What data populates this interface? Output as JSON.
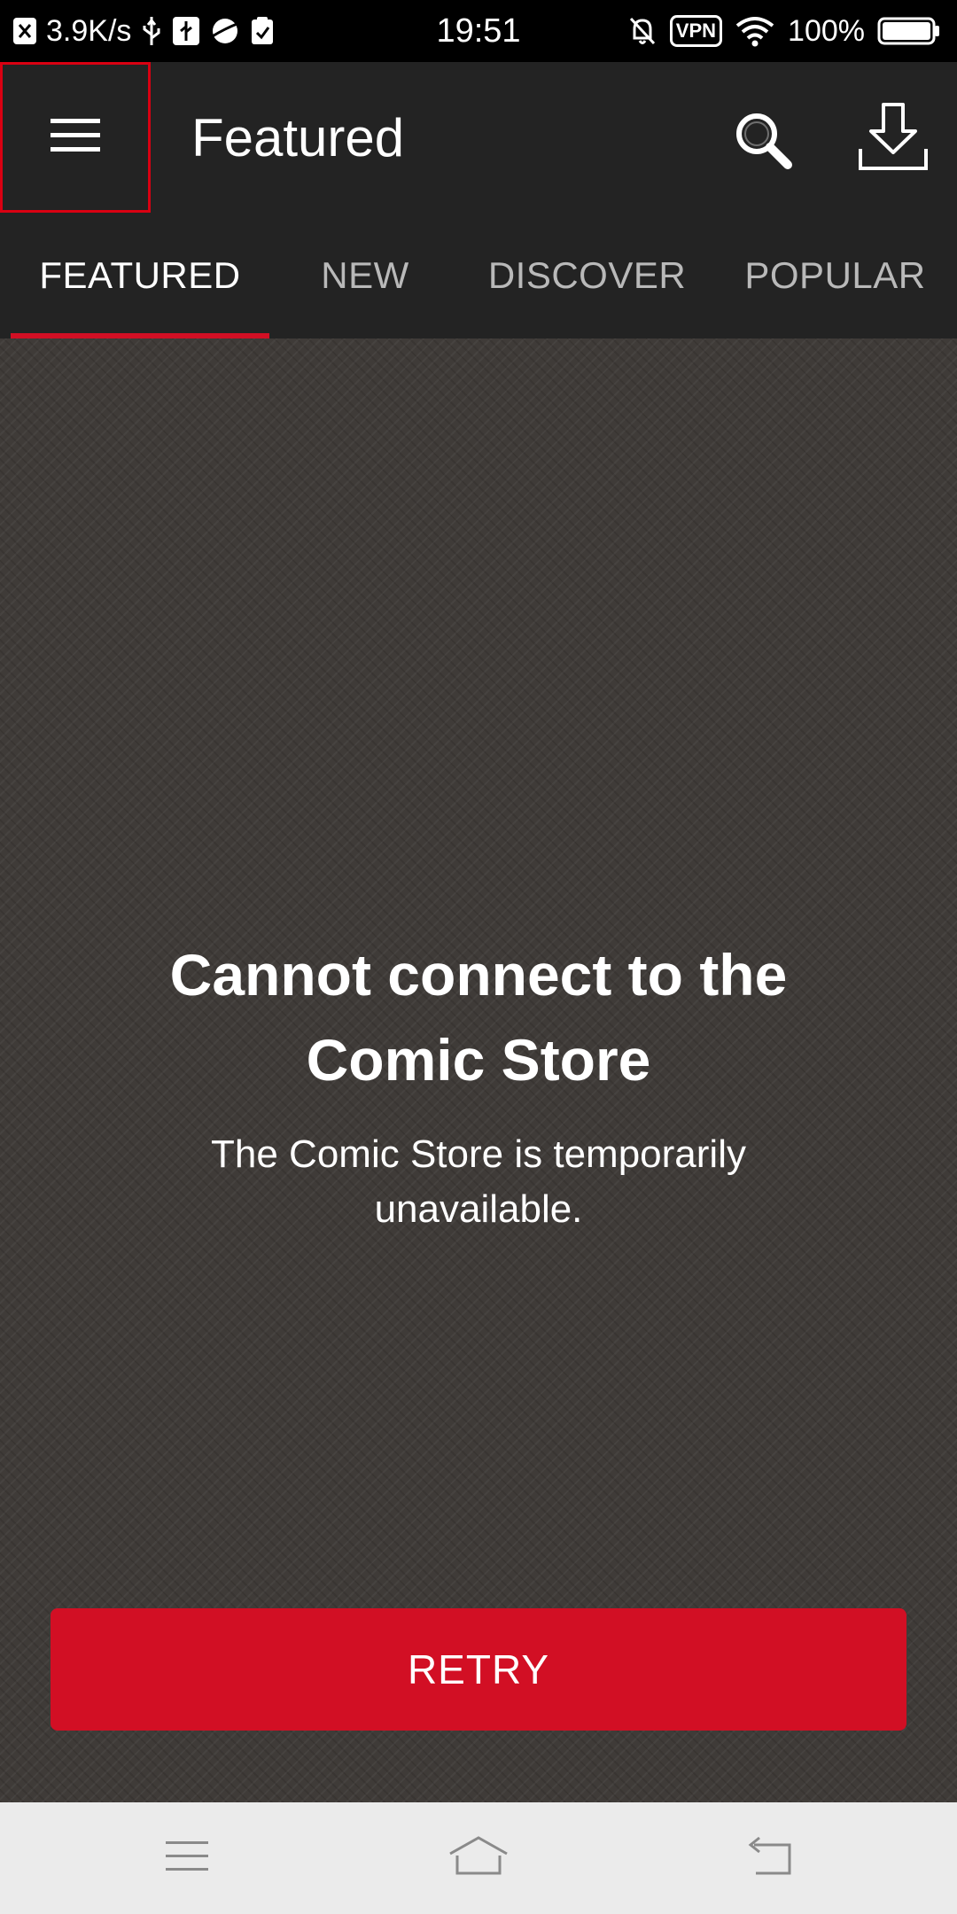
{
  "status_bar": {
    "network_speed": "3.9K/s",
    "time": "19:51",
    "vpn_label": "VPN",
    "battery_percent": "100%",
    "battery_level": 1.0
  },
  "app_bar": {
    "title": "Featured"
  },
  "tabs": [
    {
      "label": "FEATURED",
      "active": true
    },
    {
      "label": "NEW",
      "active": false
    },
    {
      "label": "DISCOVER",
      "active": false
    },
    {
      "label": "POPULAR",
      "active": false
    }
  ],
  "error": {
    "heading_line1": "Cannot connect to the",
    "heading_line2": "Comic Store",
    "message_line1": "The Comic Store is temporarily",
    "message_line2": "unavailable."
  },
  "retry_label": "RETRY",
  "colors": {
    "accent": "#d20f24",
    "app_bar_bg": "#232323",
    "content_bg": "#3f3b38"
  },
  "icons": {
    "menu": "hamburger-menu-icon",
    "search": "search-icon",
    "download": "download-icon",
    "nav_menu": "nav-menu-icon",
    "nav_home": "home-icon",
    "nav_back": "back-icon"
  }
}
